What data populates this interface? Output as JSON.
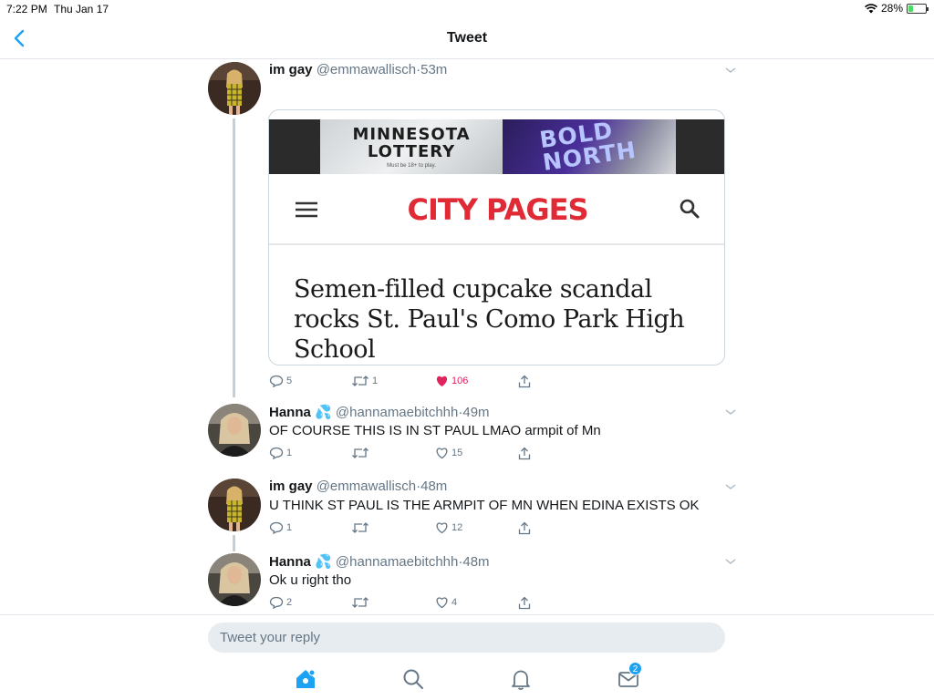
{
  "status_bar": {
    "time": "7:22 PM",
    "date": "Thu Jan 17",
    "battery": "28%",
    "battery_level": 0.28
  },
  "nav": {
    "title": "Tweet"
  },
  "tweets": [
    {
      "name": "im gay",
      "handle": "@emmawallisch",
      "sep": "·",
      "age": "53m",
      "card": {
        "ad_brand": "MINNESOTA\nLOTTERY",
        "ad_fine_print": "Must be 18+ to play.",
        "ad_campaign": "BOLD\nNORTH",
        "site_logo": "CITY PAGES",
        "headline": "Semen-filled cupcake scandal rocks St. Paul's Como Park High School"
      },
      "replies": "5",
      "retweets": "1",
      "likes": "106",
      "liked": true
    },
    {
      "name": "Hanna",
      "emoji": "💦",
      "handle": "@hannamaebitchhh",
      "sep": "·",
      "age": "49m",
      "text": "OF COURSE THIS IS IN ST PAUL LMAO armpit of Mn",
      "replies": "1",
      "retweets": "",
      "likes": "15"
    },
    {
      "name": "im gay",
      "handle": "@emmawallisch",
      "sep": "·",
      "age": "48m",
      "text": "U THINK ST PAUL IS THE ARMPIT OF MN WHEN EDINA EXISTS OK",
      "replies": "1",
      "retweets": "",
      "likes": "12"
    },
    {
      "name": "Hanna",
      "emoji": "💦",
      "handle": "@hannamaebitchhh",
      "sep": "·",
      "age": "48m",
      "text": "Ok u right tho",
      "replies": "2",
      "retweets": "",
      "likes": "4"
    }
  ],
  "reply_box": {
    "placeholder": "Tweet your reply"
  },
  "tab_bar": {
    "items": [
      {
        "icon": "home-icon"
      },
      {
        "icon": "search-icon"
      },
      {
        "icon": "bell-icon"
      },
      {
        "icon": "mail-icon",
        "badge": "2"
      }
    ]
  },
  "colors": {
    "accent": "#1da1f2",
    "like": "#e0245e",
    "text": "#14171a",
    "muted": "#657786",
    "logo_red": "#e02a35"
  }
}
